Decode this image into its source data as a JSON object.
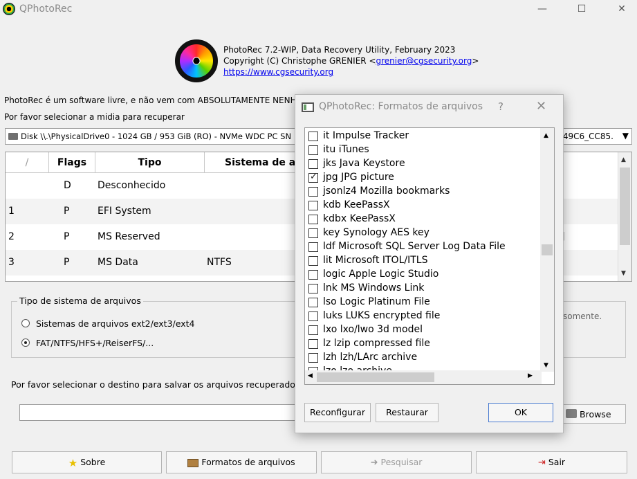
{
  "window": {
    "title": "QPhotoRec",
    "minimize": "—",
    "maximize": "☐",
    "close": "✕"
  },
  "header": {
    "line1": "PhotoRec 7.2-WIP, Data Recovery Utility, February 2023",
    "line2_prefix": "Copyright (C) Christophe GRENIER <",
    "email": "grenier@cgsecurity.org",
    "line2_suffix": ">",
    "url": "https://www.cgsecurity.org"
  },
  "free_text": "PhotoRec é um software livre, e não vem com ABSOLUTAMENTE NENHUM",
  "select_media_text": "Por favor selecionar a midia para recuperar",
  "disk": {
    "label": "Disk \\\\.\\PhysicalDrive0 - 1024 GB / 953 GiB (RO) - NVMe WDC PC SN",
    "tail": "49C6_CC85."
  },
  "partition_table": {
    "headers": [
      "/",
      "Flags",
      "Tipo",
      "Sistema de arquivos"
    ],
    "rows": [
      {
        "num": "",
        "flag": "D",
        "type": "Desconhecido",
        "fs": ""
      },
      {
        "num": "1",
        "flag": "P",
        "type": "EFI System",
        "fs": ""
      },
      {
        "num": "2",
        "flag": "P",
        "type": "MS Reserved",
        "fs": ""
      },
      {
        "num": "3",
        "flag": "P",
        "type": "MS Data",
        "fs": "NTFS"
      }
    ],
    "right_bracket": "]"
  },
  "fs_group": {
    "legend": "Tipo de sistema de arquivos",
    "option1": "Sistemas de arquivos ext2/ext3/ext4",
    "option2": "FAT/NTFS/HFS+/ReiserFS/...",
    "selected": 2,
    "side_text": "somente."
  },
  "dest_text": "Por favor selecionar o destino para salvar os arquivos recuperados.",
  "dest_value": "",
  "browse_label": "Browse",
  "buttons": {
    "about": "Sobre",
    "formats": "Formatos de arquivos",
    "search": "Pesquisar",
    "quit": "Sair"
  },
  "dialog": {
    "title": "QPhotoRec: Formatos de arquivos",
    "help": "?",
    "close": "✕",
    "items": [
      {
        "label": "it  Impulse Tracker",
        "checked": false
      },
      {
        "label": "itu  iTunes",
        "checked": false
      },
      {
        "label": "jks  Java Keystore",
        "checked": false
      },
      {
        "label": "jpg  JPG picture",
        "checked": true
      },
      {
        "label": "jsonlz4 Mozilla bookmarks",
        "checked": false
      },
      {
        "label": "kdb  KeePassX",
        "checked": false
      },
      {
        "label": "kdbx KeePassX",
        "checked": false
      },
      {
        "label": "key  Synology AES key",
        "checked": false
      },
      {
        "label": "ldf  Microsoft SQL Server Log Data File",
        "checked": false
      },
      {
        "label": "lit  Microsoft ITOL/ITLS",
        "checked": false
      },
      {
        "label": "logic Apple Logic Studio",
        "checked": false
      },
      {
        "label": "lnk  MS Windows Link",
        "checked": false
      },
      {
        "label": "lso  Logic Platinum File",
        "checked": false
      },
      {
        "label": "luks LUKS encrypted file",
        "checked": false
      },
      {
        "label": "lxo  lxo/lwo 3d model",
        "checked": false
      },
      {
        "label": "lz   lzip compressed file",
        "checked": false
      },
      {
        "label": "lzh  lzh/LArc archive",
        "checked": false
      },
      {
        "label": "lzo  lzo archive",
        "checked": false
      }
    ],
    "reconfigure": "Reconfigurar",
    "restore": "Restaurar",
    "ok": "OK"
  }
}
